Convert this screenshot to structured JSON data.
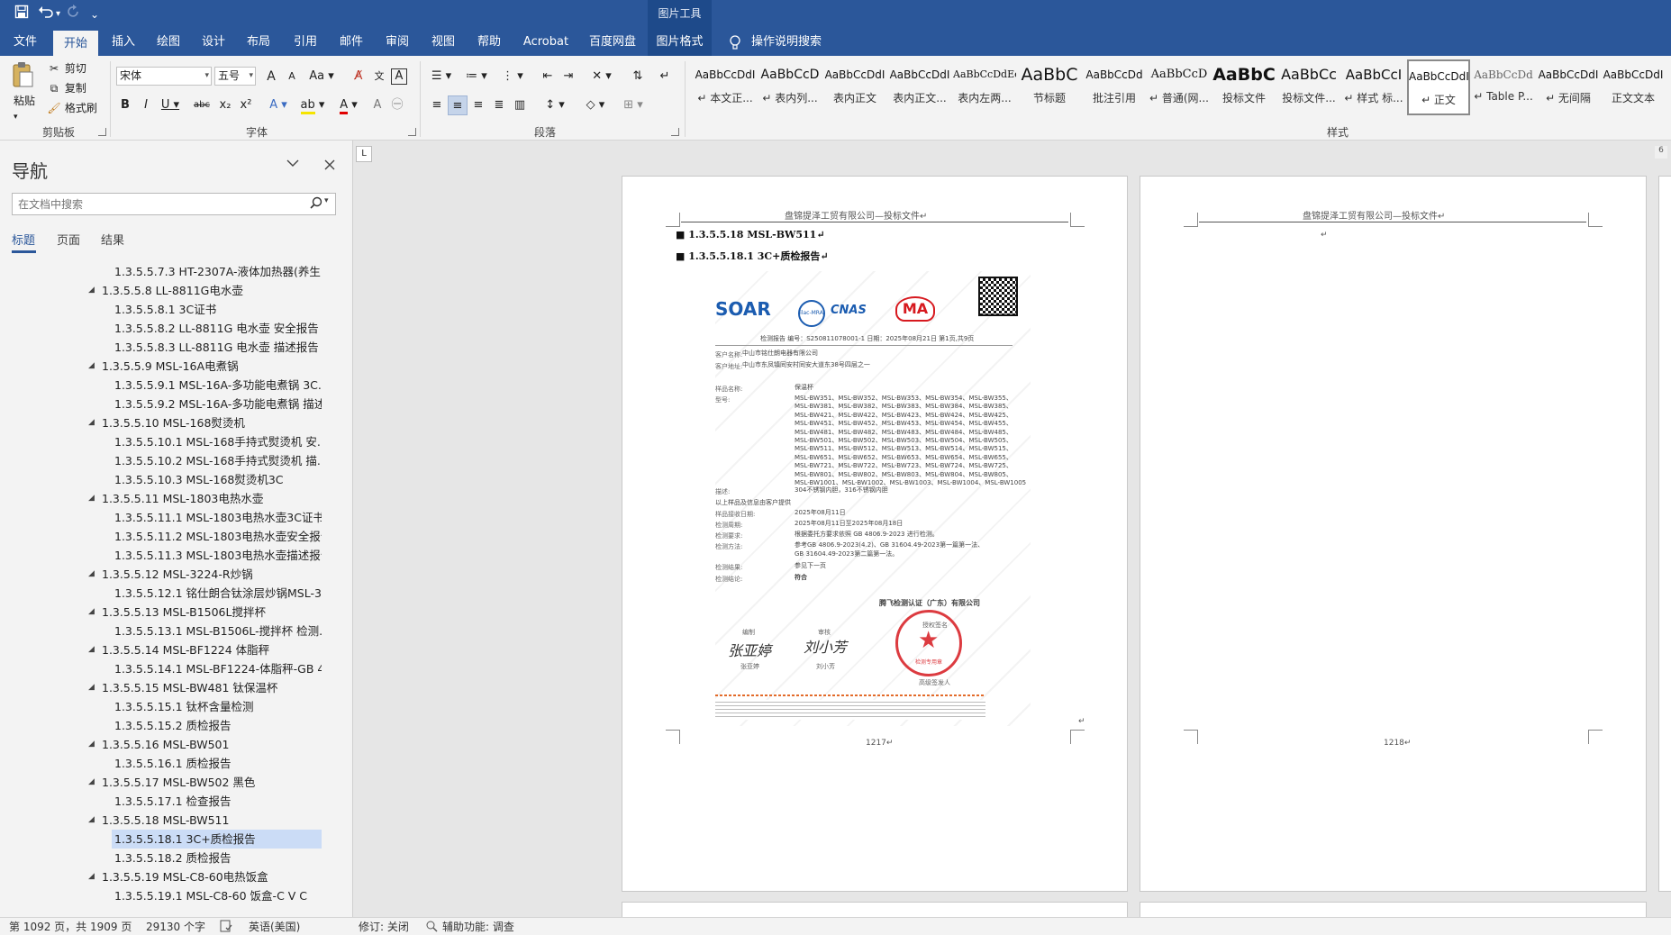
{
  "titlebar": {
    "context_header": "图片工具",
    "customize_glyph": "⌄"
  },
  "tabs": [
    {
      "label": "文件"
    },
    {
      "label": "开始"
    },
    {
      "label": "插入"
    },
    {
      "label": "绘图"
    },
    {
      "label": "设计"
    },
    {
      "label": "布局"
    },
    {
      "label": "引用"
    },
    {
      "label": "邮件"
    },
    {
      "label": "审阅"
    },
    {
      "label": "视图"
    },
    {
      "label": "帮助"
    },
    {
      "label": "Acrobat"
    },
    {
      "label": "百度网盘"
    },
    {
      "label": "图片格式"
    }
  ],
  "tell_me": "操作说明搜索",
  "clipboard": {
    "paste": "粘贴",
    "cut": "剪切",
    "copy": "复制",
    "format_painter": "格式刷",
    "group": "剪贴板"
  },
  "font": {
    "name": "宋体",
    "size": "五号",
    "group": "字体",
    "grow": "A",
    "shrink": "A",
    "change_case": "Aa",
    "wen": "文",
    "bold": "B",
    "italic": "I",
    "underline": "U",
    "strike": "abc",
    "sub": "x₂",
    "sup": "x²"
  },
  "paragraph": {
    "group": "段落"
  },
  "styles": {
    "group": "样式",
    "items": [
      {
        "preview": "AaBbCcDdI",
        "name": "↵ 本文正..."
      },
      {
        "preview": "AaBbCcD",
        "name": "↵ 表内列..."
      },
      {
        "preview": "AaBbCcDdI",
        "name": "表内正文"
      },
      {
        "preview": "AaBbCcDdI",
        "name": "表内正文..."
      },
      {
        "preview": "AaBbCcDdEe",
        "name": "表内左两..."
      },
      {
        "preview": "AaBbC",
        "name": "节标题"
      },
      {
        "preview": "AaBbCcDd",
        "name": "批注引用"
      },
      {
        "preview": "AaBbCcD",
        "name": "↵ 普通(网..."
      },
      {
        "preview": "AaBbC",
        "name": "投标文件"
      },
      {
        "preview": "AaBbCc",
        "name": "投标文件..."
      },
      {
        "preview": "AaBbCcI",
        "name": "↵ 样式 标..."
      },
      {
        "preview": "AaBbCcDdI",
        "name": "↵ 正文"
      },
      {
        "preview": "AaBbCcDd",
        "name": "↵ Table P..."
      },
      {
        "preview": "AaBbCcDdI",
        "name": "↵ 无间隔"
      },
      {
        "preview": "AaBbCcDdI",
        "name": "正文文本"
      }
    ]
  },
  "nav": {
    "title": "导航",
    "search_placeholder": "在文档中搜索",
    "tabs": [
      "标题",
      "页面",
      "结果"
    ],
    "tree": [
      {
        "label": "1.3.5.5.7.3 HT-2307A-液体加热器(养生...",
        "level": 2
      },
      {
        "label": "1.3.5.5.8 LL-8811G电水壶",
        "level": 1
      },
      {
        "label": "1.3.5.5.8.1 3C证书",
        "level": 2
      },
      {
        "label": "1.3.5.5.8.2 LL-8811G 电水壶  安全报告",
        "level": 2
      },
      {
        "label": "1.3.5.5.8.3 LL-8811G 电水壶  描述报告",
        "level": 2
      },
      {
        "label": "1.3.5.5.9 MSL-16A电煮锅",
        "level": 1
      },
      {
        "label": "1.3.5.5.9.1 MSL-16A-多功能电煮锅 3C...",
        "level": 2
      },
      {
        "label": "1.3.5.5.9.2 MSL-16A-多功能电煮锅 描述...",
        "level": 2
      },
      {
        "label": "1.3.5.5.10 MSL-168熨烫机",
        "level": 1
      },
      {
        "label": "1.3.5.5.10.1 MSL-168手持式熨烫机 安...",
        "level": 2
      },
      {
        "label": "1.3.5.5.10.2 MSL-168手持式熨烫机 描...",
        "level": 2
      },
      {
        "label": "1.3.5.5.10.3 MSL-168熨烫机3C",
        "level": 2
      },
      {
        "label": "1.3.5.5.11 MSL-1803电热水壶",
        "level": 1
      },
      {
        "label": "1.3.5.5.11.1 MSL-1803电热水壶3C证书",
        "level": 2
      },
      {
        "label": "1.3.5.5.11.2 MSL-1803电热水壶安全报告",
        "level": 2
      },
      {
        "label": "1.3.5.5.11.3 MSL-1803电热水壶描述报告",
        "level": 2
      },
      {
        "label": "1.3.5.5.12 MSL-3224-R炒锅",
        "level": 1
      },
      {
        "label": "1.3.5.5.12.1 铭仕朗合钛涂层炒锅MSL-3...",
        "level": 2
      },
      {
        "label": "1.3.5.5.13 MSL-B1506L搅拌杯",
        "level": 1
      },
      {
        "label": "1.3.5.5.13.1 MSL-B1506L-搅拌杯 检测...",
        "level": 2
      },
      {
        "label": "1.3.5.5.14 MSL-BF1224 体脂秤",
        "level": 1
      },
      {
        "label": "1.3.5.5.14.1 MSL-BF1224-体脂秤-GB 4...",
        "level": 2
      },
      {
        "label": "1.3.5.5.15 MSL-BW481 钛保温杯",
        "level": 1
      },
      {
        "label": "1.3.5.5.15.1 钛杯含量检测",
        "level": 2
      },
      {
        "label": "1.3.5.5.15.2 质检报告",
        "level": 2
      },
      {
        "label": "1.3.5.5.16 MSL-BW501",
        "level": 1
      },
      {
        "label": "1.3.5.5.16.1 质检报告",
        "level": 2
      },
      {
        "label": "1.3.5.5.17 MSL-BW502 黑色",
        "level": 1
      },
      {
        "label": "1.3.5.5.17.1 检查报告",
        "level": 2
      },
      {
        "label": "1.3.5.5.18 MSL-BW511",
        "level": 1
      },
      {
        "label": "1.3.5.5.18.1 3C+质检报告",
        "level": 2,
        "selected": true
      },
      {
        "label": "1.3.5.5.18.2 质检报告",
        "level": 2
      },
      {
        "label": "1.3.5.5.19 MSL-C8-60电热饭盒",
        "level": 1
      },
      {
        "label": "1.3.5.5.19.1 MSL-C8-60 饭盒-C V C",
        "level": 2
      }
    ]
  },
  "document": {
    "ruler_marker": "L",
    "page_count_marker": "6",
    "page_header": "盘锦提泽工贸有限公司—投标文件↵",
    "page1": {
      "heading1": "■ 1.3.5.5.18 MSL-BW511↵",
      "heading2": "■ 1.3.5.5.18.1  3C+质检报告↵",
      "page_number": "1217↵",
      "end_mark": "↵"
    },
    "page2": {
      "page_number": "1218↵",
      "para_mark": "↵"
    },
    "report": {
      "logo": "SOAR",
      "ma": "MA",
      "cnas": "CNAS",
      "ilac": "ilac-MRA",
      "header_row": "检测报告          编号：S250811078001-1          日期：2025年08月21日          第1页,共9页",
      "customer_name_label": "客户名称:",
      "customer_name": "中山市铭仕朗电器有限公司",
      "customer_addr_label": "客户地址:",
      "customer_addr": "中山市东凤镇同安村同安大道东38号四层之一",
      "sample_label": "样品名称:",
      "sample": "保温杯",
      "model_label": "型号:",
      "models": [
        "MSL-BW351、MSL-BW352、MSL-BW353、MSL-BW354、MSL-BW355、",
        "MSL-BW381、MSL-BW382、MSL-BW383、MSL-BW384、MSL-BW385、",
        "MSL-BW421、MSL-BW422、MSL-BW423、MSL-BW424、MSL-BW425、",
        "MSL-BW451、MSL-BW452、MSL-BW453、MSL-BW454、MSL-BW455、",
        "MSL-BW481、MSL-BW482、MSL-BW483、MSL-BW484、MSL-BW485、",
        "MSL-BW501、MSL-BW502、MSL-BW503、MSL-BW504、MSL-BW505、",
        "MSL-BW511、MSL-BW512、MSL-BW513、MSL-BW514、MSL-BW515、",
        "MSL-BW651、MSL-BW652、MSL-BW653、MSL-BW654、MSL-BW655、",
        "MSL-BW721、MSL-BW722、MSL-BW723、MSL-BW724、MSL-BW725、",
        "MSL-BW801、MSL-BW802、MSL-BW803、MSL-BW804、MSL-BW805、",
        "MSL-BW1001、MSL-BW1002、MSL-BW1003、MSL-BW1004、MSL-BW1005"
      ],
      "desc_label": "描述:",
      "desc": "304不锈钢内胆，316不锈钢内胆",
      "note": "以上样品及信息由客户提供",
      "recv_label": "样品接收日期:",
      "recv": "2025年08月11日",
      "period_label": "检测周期:",
      "period": "2025年08月11日至2025年08月18日",
      "req_label": "检测要求:",
      "req": "根据委托方要求依照 GB 4806.9-2023 进行检测。",
      "method_label": "检测方法:",
      "method1": "参考GB 4806.9-2023(4.2)、GB 31604.49-2023第一篇第一法、",
      "method2": "GB 31604.49-2023第二篇第一法。",
      "result_label": "检测结果:",
      "result": "参见下一页",
      "conclusion_label": "检测结论:",
      "conclusion": "符合",
      "company": "腾飞检测认证（广东）有限公司",
      "editor_label": "编制",
      "reviewer_label": "审核",
      "editor_sig": "张亚婷",
      "reviewer_sig": "刘小芳",
      "editor_name": "张亚婷",
      "reviewer_name": "刘小芳",
      "approver_label": "授权签名",
      "seal_text": "检测专用章",
      "legal_label": "高级签发人"
    }
  },
  "status": {
    "page": "第 1092 页，共 1909 页",
    "words": "29130 个字",
    "lang": "英语(美国)",
    "track": "修订: 关闭",
    "access": "辅助功能: 调查"
  },
  "colors": {
    "accent": "#2b579a",
    "context": "#1e4a8a",
    "seal": "#d7191f",
    "nav_selected": "#cbdcf6"
  }
}
